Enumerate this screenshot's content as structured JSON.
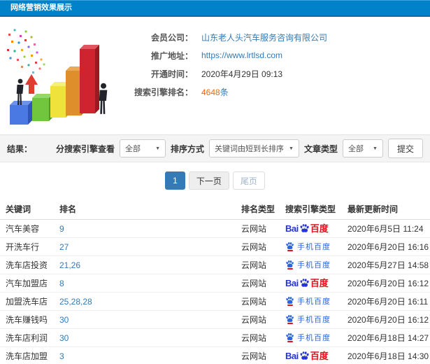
{
  "page_title": "网络营销效果展示",
  "info": {
    "member_label": "会员公司：",
    "member_value": "山东老人头汽车服务咨询有限公司",
    "promo_label": "推广地址：",
    "promo_value": "https://www.lrtlsd.com",
    "open_label": "开通时间：",
    "open_value": "2020年4月29日 09:13",
    "rank_label": "搜索引擎排名：",
    "rank_count": "4648",
    "rank_unit": "条"
  },
  "filters": {
    "result_label": "结果：",
    "engine_label": "分搜索引擎查看",
    "engine_value": "全部",
    "sort_label": "排序方式",
    "sort_value": "关键词由短到长排序",
    "article_label": "文章类型",
    "article_value": "全部",
    "submit_label": "提交"
  },
  "pagination": {
    "current": "1",
    "next_label": "下一页",
    "last_label": "尾页"
  },
  "engine_logo": {
    "bai": "Bai",
    "du": "du",
    "baidu_cn": "百度",
    "mobile_cn": "手机百度"
  },
  "table": {
    "headers": [
      "关键词",
      "排名",
      "排名类型",
      "搜索引擎类型",
      "最新更新时间"
    ],
    "rows": [
      {
        "keyword": "汽车美容",
        "rank": "9",
        "rank_type": "云网站",
        "engine": "baidu",
        "time": "2020年6月5日 11:24"
      },
      {
        "keyword": "开洗车行",
        "rank": "27",
        "rank_type": "云网站",
        "engine": "mobile-baidu",
        "time": "2020年6月20日 16:16"
      },
      {
        "keyword": "洗车店投资",
        "rank": "21,26",
        "rank_type": "云网站",
        "engine": "mobile-baidu",
        "time": "2020年5月27日 14:58"
      },
      {
        "keyword": "汽车加盟店",
        "rank": "8",
        "rank_type": "云网站",
        "engine": "baidu",
        "time": "2020年6月20日 16:12"
      },
      {
        "keyword": "加盟洗车店",
        "rank": "25,28,28",
        "rank_type": "云网站",
        "engine": "mobile-baidu",
        "time": "2020年6月20日 16:11"
      },
      {
        "keyword": "洗车赚钱吗",
        "rank": "30",
        "rank_type": "云网站",
        "engine": "mobile-baidu",
        "time": "2020年6月20日 16:12"
      },
      {
        "keyword": "洗车店利润",
        "rank": "30",
        "rank_type": "云网站",
        "engine": "mobile-baidu",
        "time": "2020年6月18日 14:27"
      },
      {
        "keyword": "洗车店加盟",
        "rank": "3",
        "rank_type": "云网站",
        "engine": "baidu",
        "time": "2020年6月18日 14:30"
      }
    ]
  },
  "colors": {
    "header_blue": "#0082ca",
    "link_blue": "#337ab7",
    "accent_orange": "#ff6600",
    "baidu_blue": "#2433dc",
    "baidu_red": "#e0121b",
    "strip_gray": "#f4f4f4"
  }
}
